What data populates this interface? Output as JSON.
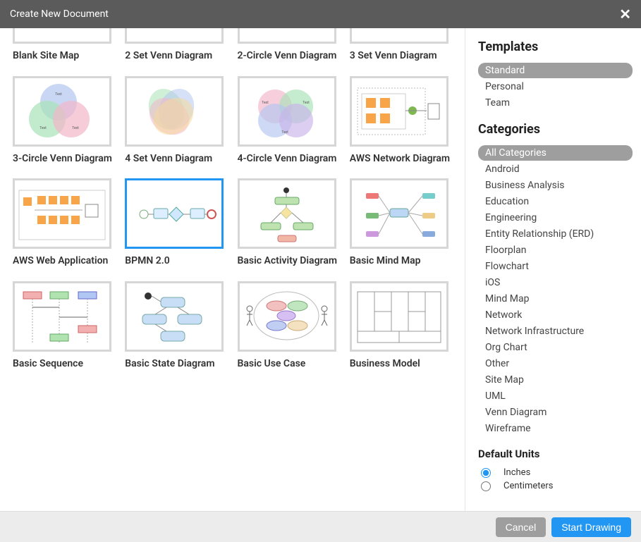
{
  "dialog": {
    "title": "Create New Document"
  },
  "templates_row0": [
    {
      "label": "Blank Site Map",
      "kind": "blank"
    },
    {
      "label": "2 Set Venn Diagram",
      "kind": "blank"
    },
    {
      "label": "2-Circle Venn Diagram",
      "kind": "blank"
    },
    {
      "label": "3 Set Venn Diagram",
      "kind": "blank"
    }
  ],
  "templates": [
    {
      "label": "3-Circle Venn Diagram",
      "kind": "venn3"
    },
    {
      "label": "4 Set Venn Diagram",
      "kind": "venn4"
    },
    {
      "label": "4-Circle Venn Diagram",
      "kind": "venn4b"
    },
    {
      "label": "AWS Network Diagram",
      "kind": "aws"
    },
    {
      "label": "AWS Web Application",
      "kind": "aws2"
    },
    {
      "label": "BPMN 2.0",
      "kind": "bpmn",
      "selected": true
    },
    {
      "label": "Basic Activity Diagram",
      "kind": "activity"
    },
    {
      "label": "Basic Mind Map",
      "kind": "mindmap"
    },
    {
      "label": "Basic Sequence",
      "kind": "sequence"
    },
    {
      "label": "Basic State Diagram",
      "kind": "state"
    },
    {
      "label": "Basic Use Case",
      "kind": "usecase"
    },
    {
      "label": "Business Model",
      "kind": "bizmodel"
    }
  ],
  "sidebar": {
    "templates_heading": "Templates",
    "template_groups": [
      {
        "label": "Standard",
        "active": true
      },
      {
        "label": "Personal"
      },
      {
        "label": "Team"
      }
    ],
    "categories_heading": "Categories",
    "categories": [
      {
        "label": "All Categories",
        "active": true
      },
      {
        "label": "Android"
      },
      {
        "label": "Business Analysis"
      },
      {
        "label": "Education"
      },
      {
        "label": "Engineering"
      },
      {
        "label": "Entity Relationship (ERD)"
      },
      {
        "label": "Floorplan"
      },
      {
        "label": "Flowchart"
      },
      {
        "label": "iOS"
      },
      {
        "label": "Mind Map"
      },
      {
        "label": "Network"
      },
      {
        "label": "Network Infrastructure"
      },
      {
        "label": "Org Chart"
      },
      {
        "label": "Other"
      },
      {
        "label": "Site Map"
      },
      {
        "label": "UML"
      },
      {
        "label": "Venn Diagram"
      },
      {
        "label": "Wireframe"
      }
    ],
    "units_heading": "Default Units",
    "units": [
      {
        "label": "Inches",
        "checked": true
      },
      {
        "label": "Centimeters",
        "checked": false
      }
    ]
  },
  "footer": {
    "cancel": "Cancel",
    "start": "Start Drawing"
  }
}
